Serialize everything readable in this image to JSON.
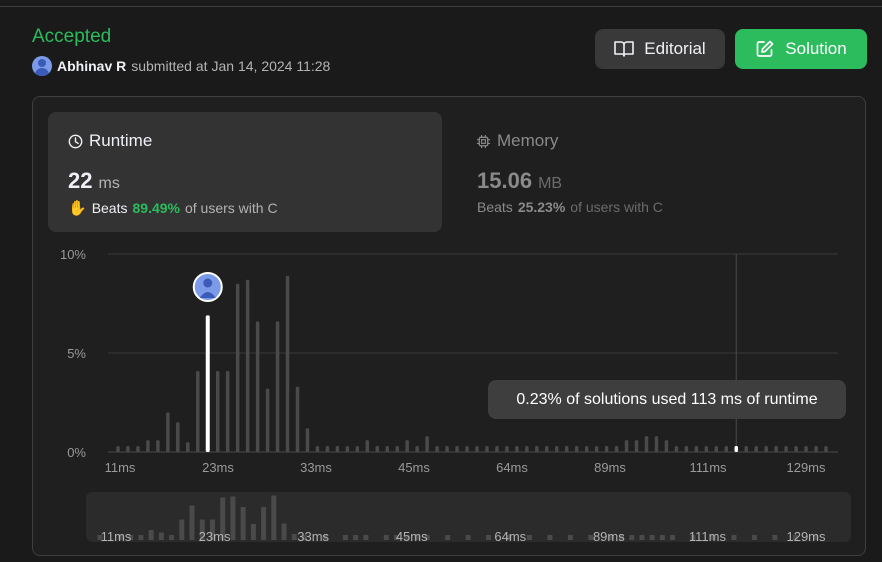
{
  "header": {
    "status": "Accepted",
    "user": "Abhinav R",
    "submitted_text": "submitted at",
    "date": "Jan 14, 2024 11:28"
  },
  "buttons": {
    "editorial": "Editorial",
    "solution": "Solution"
  },
  "runtime": {
    "title": "Runtime",
    "value": "22",
    "unit": "ms",
    "beats_label": "Beats",
    "beats_pct": "89.49%",
    "beats_suffix": "of users with C"
  },
  "memory": {
    "title": "Memory",
    "value": "15.06",
    "unit": "MB",
    "beats_label": "Beats",
    "beats_pct": "25.23%",
    "beats_suffix": "of users with C"
  },
  "tooltip": "0.23% of solutions used 113 ms of runtime",
  "colors": {
    "accent_green": "#2cbb5d",
    "bar": "#4a4a4a",
    "highlight": "#ffffff"
  },
  "chart_data": {
    "type": "bar",
    "ylabel": "",
    "xlabel": "",
    "ylim": [
      0,
      10
    ],
    "y_ticks": [
      "0%",
      "5%",
      "10%"
    ],
    "x_tick_labels": [
      "11ms",
      "23ms",
      "33ms",
      "45ms",
      "64ms",
      "89ms",
      "111ms",
      "129ms"
    ],
    "values": [
      0.3,
      0.3,
      0.3,
      0.6,
      0.6,
      2.0,
      1.5,
      0.5,
      4.1,
      6.9,
      4.1,
      4.1,
      8.5,
      8.7,
      6.6,
      3.2,
      6.6,
      8.9,
      3.3,
      1.2,
      0.3,
      0.3,
      0.3,
      0.3,
      0.3,
      0.6,
      0.3,
      0.3,
      0.3,
      0.6,
      0.3,
      0.8,
      0.3,
      0.3,
      0.3,
      0.3,
      0.3,
      0.3,
      0.3,
      0.3,
      0.3,
      0.3,
      0.3,
      0.3,
      0.3,
      0.3,
      0.3,
      0.3,
      0.3,
      0.3,
      0.3,
      0.6,
      0.6,
      0.8,
      0.8,
      0.6,
      0.3,
      0.3,
      0.3,
      0.3,
      0.3,
      0.3,
      0.3,
      0.3,
      0.3,
      0.3,
      0.3,
      0.3,
      0.3,
      0.3,
      0.3,
      0.3
    ],
    "highlight_index": 9,
    "marked_index": 62
  }
}
